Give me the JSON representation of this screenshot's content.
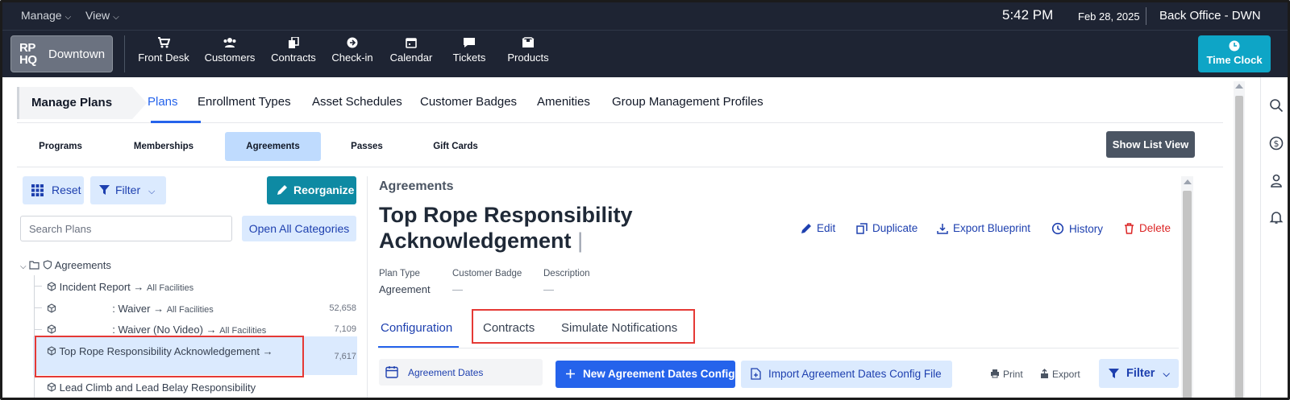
{
  "topbar": {
    "menus": [
      "Manage",
      "View"
    ],
    "time": "5:42 PM",
    "date": "Feb 28, 2025",
    "office": "Back Office - DWN"
  },
  "navbar": {
    "logo": "RP HQ",
    "location": "Downtown",
    "items": [
      "Front Desk",
      "Customers",
      "Contracts",
      "Check-in",
      "Calendar",
      "Tickets",
      "Products"
    ],
    "time_clock": "Time Clock"
  },
  "subnav": {
    "breadcrumb": "Manage Plans",
    "tabs": [
      "Plans",
      "Enrollment Types",
      "Asset Schedules",
      "Customer Badges",
      "Amenities",
      "Group Management Profiles"
    ],
    "active_tab": "Plans"
  },
  "plan_tabs": {
    "items": [
      "Programs",
      "Memberships",
      "Agreements",
      "Passes",
      "Gift Cards"
    ],
    "active": "Agreements",
    "show_list_view": "Show List View"
  },
  "left_panel": {
    "reset": "Reset",
    "filter": "Filter",
    "reorganize": "Reorganize",
    "search_placeholder": "Search Plans",
    "open_all": "Open All Categories",
    "category": "Agreements",
    "rows": [
      {
        "name": "Incident Report",
        "arrow": "→",
        "scope": "All Facilities",
        "count": ""
      },
      {
        "name": ": Waiver",
        "arrow": "→",
        "scope": "All Facilities",
        "count": "52,658"
      },
      {
        "name": ": Waiver (No Video)",
        "arrow": "→",
        "scope": "All Facilities",
        "count": "7,109"
      },
      {
        "name": "Top Rope Responsibility Acknowledgement",
        "arrow": "→",
        "scope": "",
        "count": "7,617"
      },
      {
        "name": "Lead Climb and Lead Belay Responsibility",
        "arrow": "",
        "scope": "",
        "count": ""
      }
    ]
  },
  "detail": {
    "section_label": "Agreements",
    "title_line1": "Top Rope Responsibility",
    "title_line2": "Acknowledgement",
    "caret": "|",
    "actions": [
      "Edit",
      "Duplicate",
      "Export Blueprint",
      "History",
      "Delete"
    ],
    "meta": [
      {
        "label": "Plan Type",
        "value": "Agreement"
      },
      {
        "label": "Customer Badge",
        "value": "—"
      },
      {
        "label": "Description",
        "value": "—"
      }
    ],
    "tabs": [
      "Configuration",
      "Contracts",
      "Simulate Notifications"
    ],
    "active_tab": "Configuration",
    "side_item": "Agreement Dates",
    "new_config": "New Agreement Dates Config",
    "import_config": "Import Agreement Dates Config File",
    "print": "Print",
    "export": "Export",
    "filter": "Filter"
  },
  "colors": {
    "nav_bg": "#1e2433",
    "accent_blue": "#2563eb",
    "light_blue": "#dbeafe",
    "teal": "#0e8aa3",
    "danger": "#dc2626",
    "annotation": "#e53935"
  }
}
